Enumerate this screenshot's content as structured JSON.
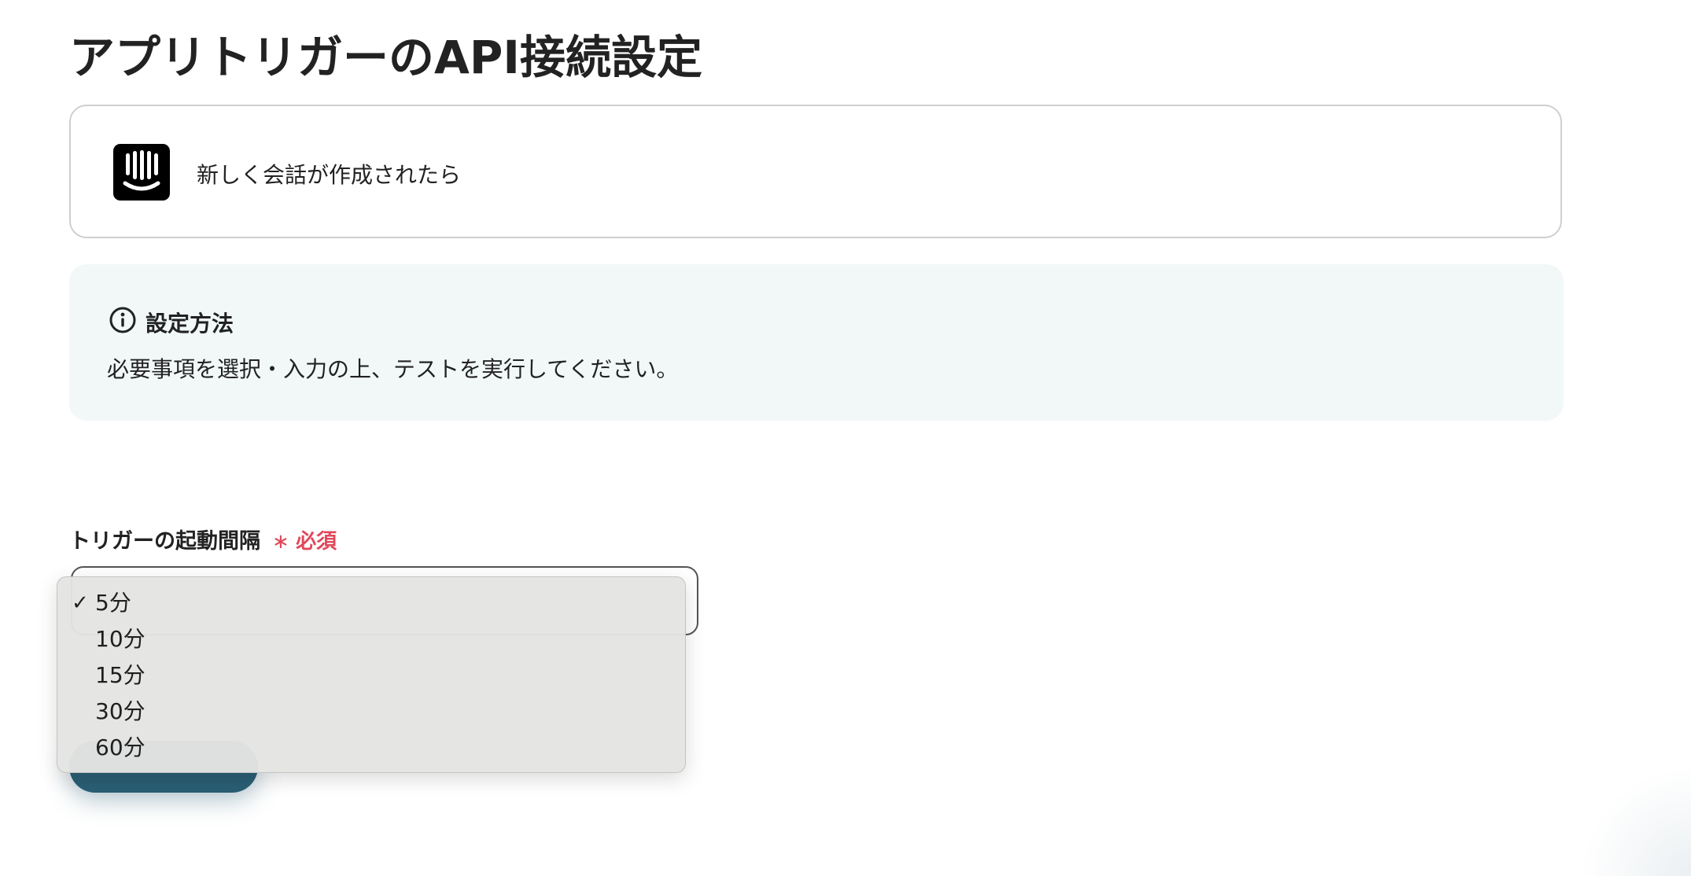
{
  "page": {
    "title": "アプリトリガーのAPI接続設定"
  },
  "trigger": {
    "app_icon": "intercom-logo-icon",
    "label": "新しく会話が作成されたら"
  },
  "info": {
    "icon": "info-circle-icon",
    "title": "設定方法",
    "text": "必要事項を選択・入力の上、テストを実行してください。"
  },
  "interval_field": {
    "label": "トリガーの起動間隔",
    "required_mark": "∗",
    "required_text": "必須",
    "selected_value": "5分",
    "options": [
      {
        "label": "5分",
        "checked": true
      },
      {
        "label": "10分",
        "checked": false
      },
      {
        "label": "15分",
        "checked": false
      },
      {
        "label": "30分",
        "checked": false
      },
      {
        "label": "60分",
        "checked": false
      }
    ]
  },
  "colors": {
    "text": "#222222",
    "card_border": "#cfcfcf",
    "info_background": "#f2f8f8",
    "required": "#e0485a",
    "button": "#2a5f75",
    "dropdown_background": "#e4e4e2"
  }
}
